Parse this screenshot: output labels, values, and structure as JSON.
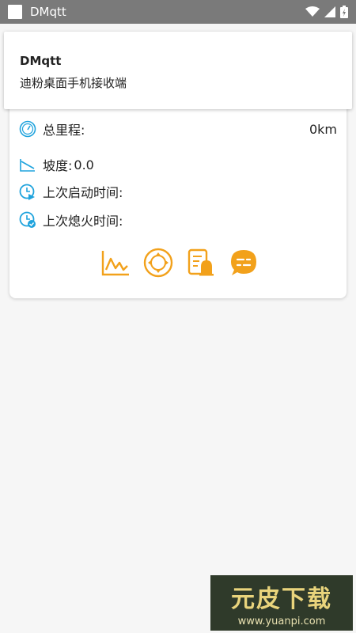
{
  "statusbar": {
    "title": "DMqtt",
    "icons": [
      "app-square-icon",
      "wifi-icon",
      "signal-icon",
      "battery-icon"
    ]
  },
  "notification": {
    "title": "DMqtt",
    "text": "迪粉桌面手机接收端"
  },
  "card": {
    "rows": [
      {
        "icon": "speedometer-icon",
        "label": "总里程:",
        "value": "0km"
      },
      {
        "icon": "slope-icon",
        "label": "坡度:",
        "value": "0.0"
      },
      {
        "icon": "start-time-icon",
        "label": "上次启动时间:",
        "value": ""
      },
      {
        "icon": "off-time-icon",
        "label": "上次熄火时间:",
        "value": ""
      }
    ],
    "actions": [
      "chart-icon",
      "direction-pad-icon",
      "alarm-document-icon",
      "chat-icon"
    ]
  },
  "colors": {
    "accent_blue": "#1fa3dd",
    "accent_orange": "#f2a11b",
    "statusbar": "#7a7a7a"
  },
  "watermark": {
    "logo": "元皮下载",
    "url": "www.yuanpi.com"
  }
}
